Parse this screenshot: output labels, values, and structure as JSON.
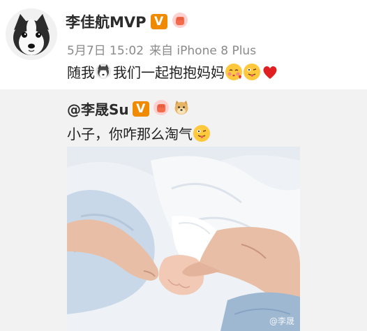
{
  "post": {
    "username": "李佳航MVP",
    "date": "5月7日 15:02",
    "source": "来自 iPhone 8 Plus",
    "text_a": "随我",
    "text_b": "我们一起抱抱妈妈"
  },
  "badges": {
    "verified": "V"
  },
  "repost": {
    "username": "@李晟Su",
    "text": "小子，你咋那么淘气",
    "watermark": "@李晟"
  },
  "icons": [
    "husky-avatar",
    "verified-icon",
    "fist-icon",
    "husky-face-icon",
    "kiss-face-icon",
    "tongue-face-icon",
    "red-heart-icon",
    "doge-icon"
  ]
}
